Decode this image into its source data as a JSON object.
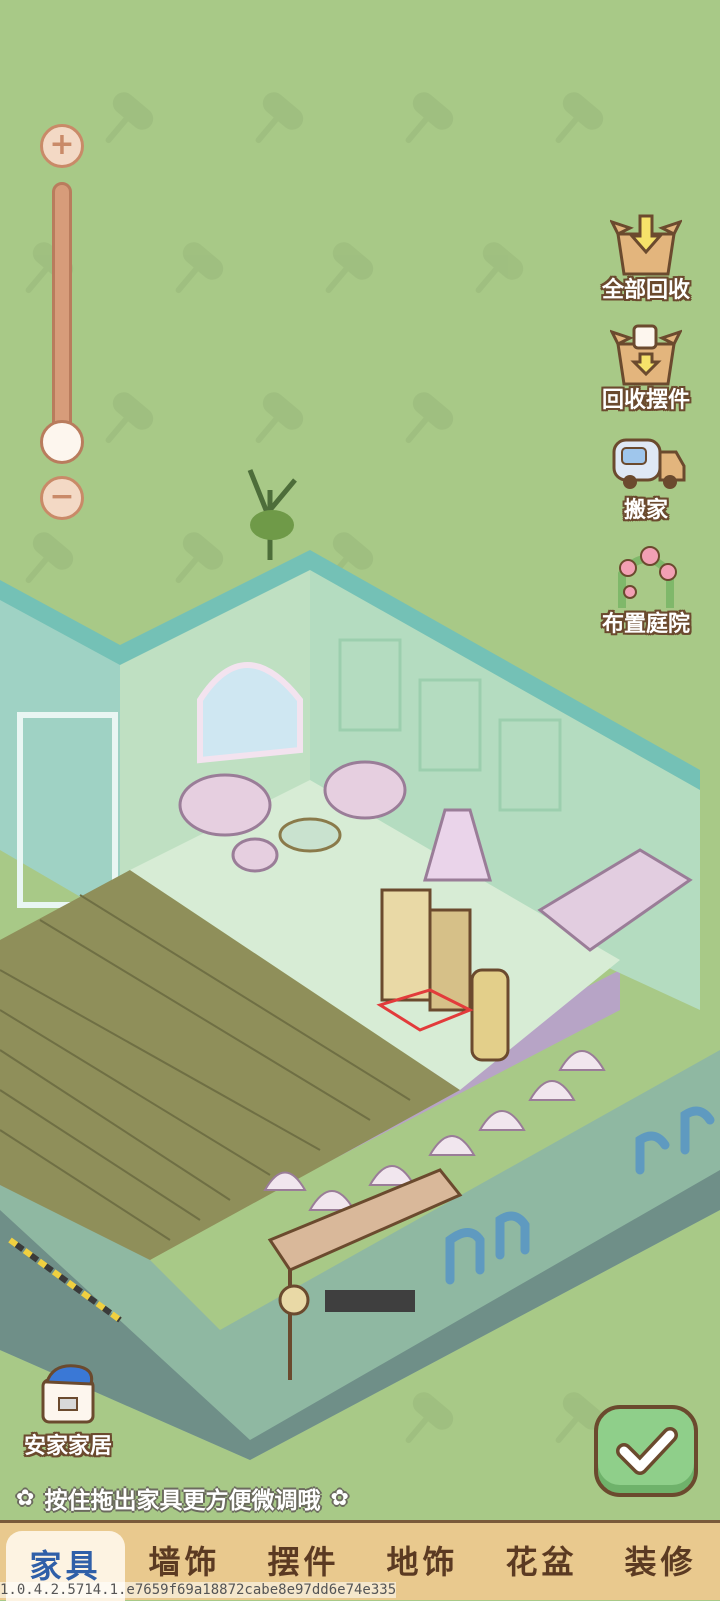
{
  "zoom": {
    "plus_label": "+",
    "minus_label": "−",
    "level": 0.05
  },
  "side_actions": [
    {
      "id": "recycle-all",
      "label": "全部回收",
      "icon": "box-arrow-icon"
    },
    {
      "id": "recycle-decor",
      "label": "回收摆件",
      "icon": "box-cup-icon"
    },
    {
      "id": "move-house",
      "label": "搬家",
      "icon": "moving-truck-icon"
    },
    {
      "id": "garden",
      "label": "布置庭院",
      "icon": "flower-arch-icon"
    }
  ],
  "brand": {
    "label": "安家家居",
    "icon": "shopping-bag-icon"
  },
  "confirm": {
    "icon": "checkmark-icon"
  },
  "hint": {
    "text": "按住拖出家具更方便微调哦",
    "icon": "flower-icon"
  },
  "tabs": [
    {
      "label": "家具",
      "active": true
    },
    {
      "label": "墙饰",
      "active": false
    },
    {
      "label": "摆件",
      "active": false
    },
    {
      "label": "地饰",
      "active": false
    },
    {
      "label": "花盆",
      "active": false
    },
    {
      "label": "装修",
      "active": false
    }
  ],
  "version": "1.0.4.2.5714.1.e7659f69a18872cabe8e97dd6e74e335",
  "colors": {
    "background": "#a8c987",
    "tab_bar": "#e9c98e",
    "confirm": "#8fcf8a",
    "outline": "#6b4a2e",
    "active_tab_text": "#2f5fa8"
  }
}
